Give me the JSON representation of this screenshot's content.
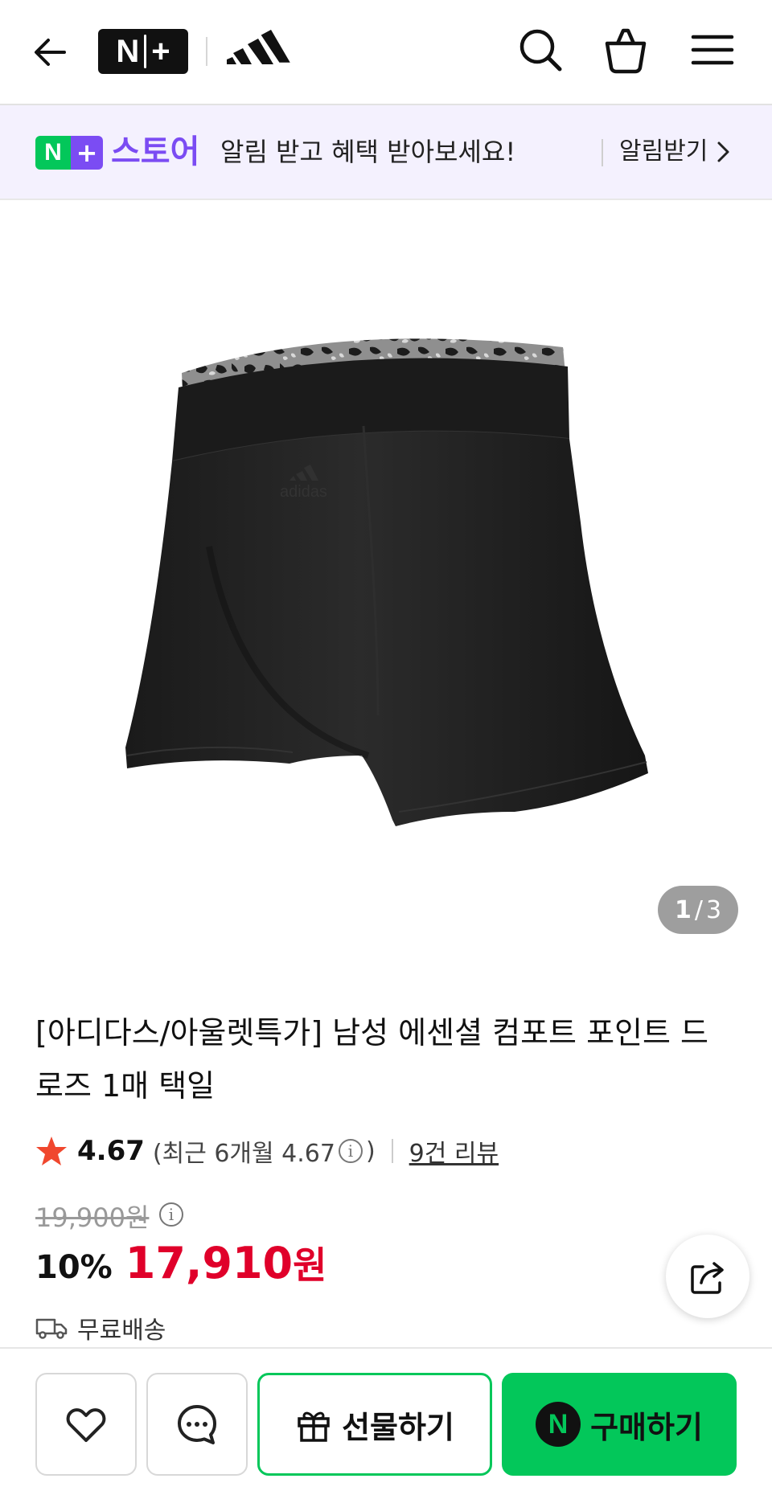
{
  "header": {
    "logo_text": [
      "N",
      "+"
    ],
    "icons": [
      "back-arrow-icon",
      "adidas-logo",
      "search-icon",
      "shopping-bag-icon",
      "menu-icon"
    ]
  },
  "banner": {
    "badge_n": "N",
    "badge_plus": "+",
    "store_label": "스토어",
    "message": "알림 받고 혜택 받아보세요!",
    "notify_label": "알림받기"
  },
  "gallery": {
    "current": "1",
    "separator": "/",
    "total": "3"
  },
  "product": {
    "title": "[아디다스/아울렛특가] 남성 에센셜 컴포트 포인트 드로즈 1매 택일",
    "rating": "4.67",
    "recent_open": "(최근 6개월 4.67",
    "recent_close": ")",
    "reviews_link": "9건 리뷰",
    "original_price": "19,900원",
    "discount": "10%",
    "price": "17,910",
    "currency": "원",
    "shipping": "무료배송"
  },
  "bottom_bar": {
    "gift_label": "선물하기",
    "buy_label": "구매하기",
    "buy_badge": "N"
  },
  "colors": {
    "naver_green": "#03c75a",
    "nplus_purple": "#7b4cf3",
    "price_red": "#e0002a",
    "banner_bg": "#f4f1fe"
  }
}
